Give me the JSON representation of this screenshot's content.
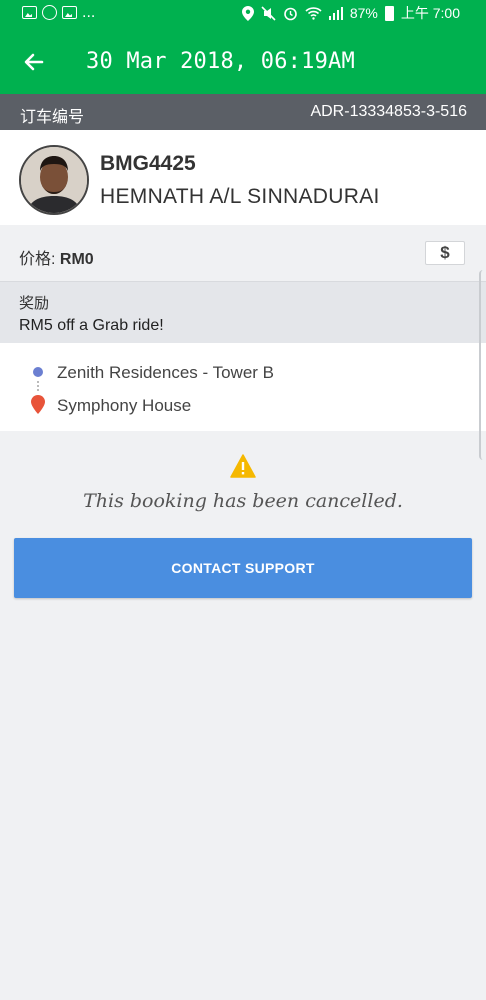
{
  "status_bar": {
    "ellipsis": "...",
    "battery": "87%",
    "time": "上午 7:00"
  },
  "app_bar": {
    "title": "30 Mar 2018, 06:19AM"
  },
  "booking": {
    "label": "订车编号",
    "id": "ADR-13334853-3-516"
  },
  "driver": {
    "plate": "BMG4425",
    "name": "HEMNATH A/L SINNADURAI"
  },
  "price": {
    "label": "价格: ",
    "value": "RM0",
    "button_icon": "$"
  },
  "promo": {
    "label": "奖励",
    "text": "RM5 off a Grab ride!"
  },
  "route": {
    "pickup": "Zenith Residences - Tower B",
    "dropoff": "Symphony House"
  },
  "status": {
    "message": "This booking has been cancelled."
  },
  "actions": {
    "contact_support": "CONTACT SUPPORT"
  },
  "colors": {
    "brand_green": "#00b14f",
    "button_blue": "#4a8ee0",
    "warning": "#f5b800",
    "pickup": "#6b7fd1",
    "dropoff": "#e8543a"
  }
}
